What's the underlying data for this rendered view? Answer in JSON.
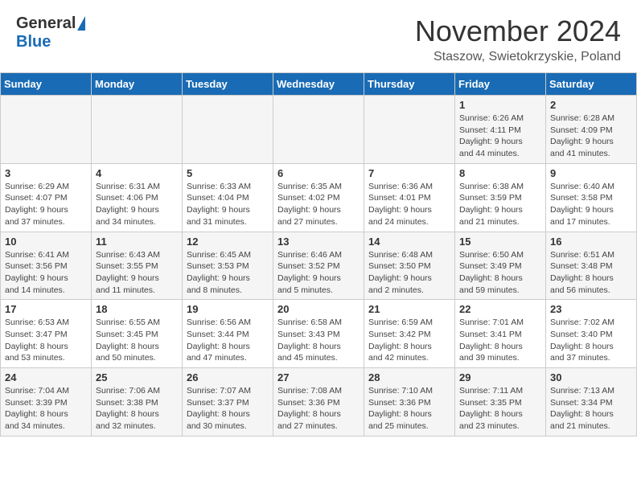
{
  "header": {
    "logo_general": "General",
    "logo_blue": "Blue",
    "month_title": "November 2024",
    "location": "Staszow, Swietokrzyskie, Poland"
  },
  "days_of_week": [
    "Sunday",
    "Monday",
    "Tuesday",
    "Wednesday",
    "Thursday",
    "Friday",
    "Saturday"
  ],
  "weeks": [
    [
      {
        "day": "",
        "info": ""
      },
      {
        "day": "",
        "info": ""
      },
      {
        "day": "",
        "info": ""
      },
      {
        "day": "",
        "info": ""
      },
      {
        "day": "",
        "info": ""
      },
      {
        "day": "1",
        "info": "Sunrise: 6:26 AM\nSunset: 4:11 PM\nDaylight: 9 hours\nand 44 minutes."
      },
      {
        "day": "2",
        "info": "Sunrise: 6:28 AM\nSunset: 4:09 PM\nDaylight: 9 hours\nand 41 minutes."
      }
    ],
    [
      {
        "day": "3",
        "info": "Sunrise: 6:29 AM\nSunset: 4:07 PM\nDaylight: 9 hours\nand 37 minutes."
      },
      {
        "day": "4",
        "info": "Sunrise: 6:31 AM\nSunset: 4:06 PM\nDaylight: 9 hours\nand 34 minutes."
      },
      {
        "day": "5",
        "info": "Sunrise: 6:33 AM\nSunset: 4:04 PM\nDaylight: 9 hours\nand 31 minutes."
      },
      {
        "day": "6",
        "info": "Sunrise: 6:35 AM\nSunset: 4:02 PM\nDaylight: 9 hours\nand 27 minutes."
      },
      {
        "day": "7",
        "info": "Sunrise: 6:36 AM\nSunset: 4:01 PM\nDaylight: 9 hours\nand 24 minutes."
      },
      {
        "day": "8",
        "info": "Sunrise: 6:38 AM\nSunset: 3:59 PM\nDaylight: 9 hours\nand 21 minutes."
      },
      {
        "day": "9",
        "info": "Sunrise: 6:40 AM\nSunset: 3:58 PM\nDaylight: 9 hours\nand 17 minutes."
      }
    ],
    [
      {
        "day": "10",
        "info": "Sunrise: 6:41 AM\nSunset: 3:56 PM\nDaylight: 9 hours\nand 14 minutes."
      },
      {
        "day": "11",
        "info": "Sunrise: 6:43 AM\nSunset: 3:55 PM\nDaylight: 9 hours\nand 11 minutes."
      },
      {
        "day": "12",
        "info": "Sunrise: 6:45 AM\nSunset: 3:53 PM\nDaylight: 9 hours\nand 8 minutes."
      },
      {
        "day": "13",
        "info": "Sunrise: 6:46 AM\nSunset: 3:52 PM\nDaylight: 9 hours\nand 5 minutes."
      },
      {
        "day": "14",
        "info": "Sunrise: 6:48 AM\nSunset: 3:50 PM\nDaylight: 9 hours\nand 2 minutes."
      },
      {
        "day": "15",
        "info": "Sunrise: 6:50 AM\nSunset: 3:49 PM\nDaylight: 8 hours\nand 59 minutes."
      },
      {
        "day": "16",
        "info": "Sunrise: 6:51 AM\nSunset: 3:48 PM\nDaylight: 8 hours\nand 56 minutes."
      }
    ],
    [
      {
        "day": "17",
        "info": "Sunrise: 6:53 AM\nSunset: 3:47 PM\nDaylight: 8 hours\nand 53 minutes."
      },
      {
        "day": "18",
        "info": "Sunrise: 6:55 AM\nSunset: 3:45 PM\nDaylight: 8 hours\nand 50 minutes."
      },
      {
        "day": "19",
        "info": "Sunrise: 6:56 AM\nSunset: 3:44 PM\nDaylight: 8 hours\nand 47 minutes."
      },
      {
        "day": "20",
        "info": "Sunrise: 6:58 AM\nSunset: 3:43 PM\nDaylight: 8 hours\nand 45 minutes."
      },
      {
        "day": "21",
        "info": "Sunrise: 6:59 AM\nSunset: 3:42 PM\nDaylight: 8 hours\nand 42 minutes."
      },
      {
        "day": "22",
        "info": "Sunrise: 7:01 AM\nSunset: 3:41 PM\nDaylight: 8 hours\nand 39 minutes."
      },
      {
        "day": "23",
        "info": "Sunrise: 7:02 AM\nSunset: 3:40 PM\nDaylight: 8 hours\nand 37 minutes."
      }
    ],
    [
      {
        "day": "24",
        "info": "Sunrise: 7:04 AM\nSunset: 3:39 PM\nDaylight: 8 hours\nand 34 minutes."
      },
      {
        "day": "25",
        "info": "Sunrise: 7:06 AM\nSunset: 3:38 PM\nDaylight: 8 hours\nand 32 minutes."
      },
      {
        "day": "26",
        "info": "Sunrise: 7:07 AM\nSunset: 3:37 PM\nDaylight: 8 hours\nand 30 minutes."
      },
      {
        "day": "27",
        "info": "Sunrise: 7:08 AM\nSunset: 3:36 PM\nDaylight: 8 hours\nand 27 minutes."
      },
      {
        "day": "28",
        "info": "Sunrise: 7:10 AM\nSunset: 3:36 PM\nDaylight: 8 hours\nand 25 minutes."
      },
      {
        "day": "29",
        "info": "Sunrise: 7:11 AM\nSunset: 3:35 PM\nDaylight: 8 hours\nand 23 minutes."
      },
      {
        "day": "30",
        "info": "Sunrise: 7:13 AM\nSunset: 3:34 PM\nDaylight: 8 hours\nand 21 minutes."
      }
    ]
  ]
}
